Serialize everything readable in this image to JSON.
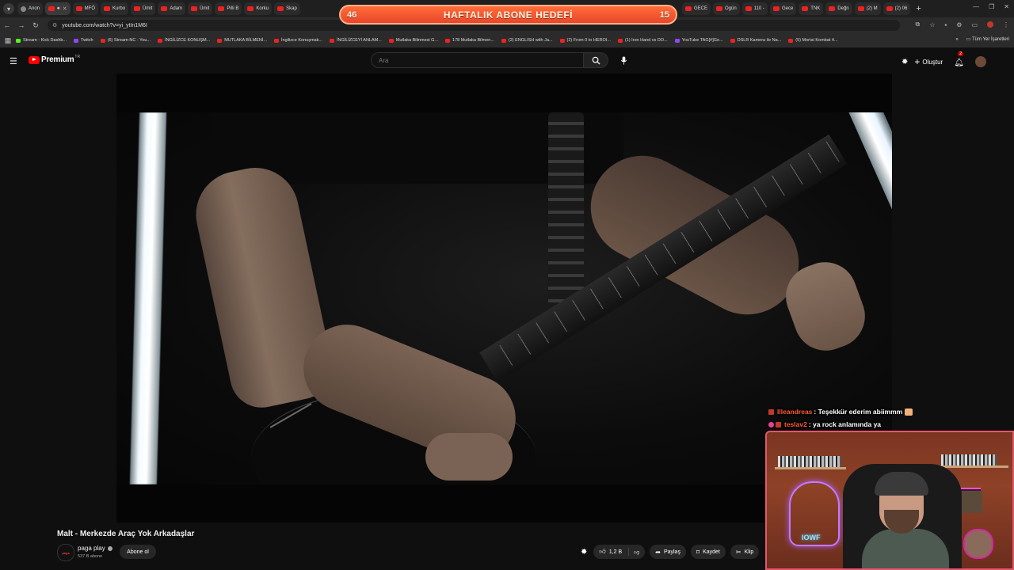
{
  "browser": {
    "tabs": [
      {
        "label": "Anon",
        "active": false
      },
      {
        "label": "",
        "active": true
      },
      {
        "label": "MFÖ",
        "active": false
      },
      {
        "label": "Kurbo",
        "active": false
      },
      {
        "label": "Ümit",
        "active": false
      },
      {
        "label": "Adam",
        "active": false
      },
      {
        "label": "Ümit",
        "active": false
      },
      {
        "label": "Pilli B",
        "active": false
      },
      {
        "label": "Korku",
        "active": false
      },
      {
        "label": "Skap",
        "active": false
      },
      {
        "label": "GECE",
        "active": false
      },
      {
        "label": "Ogün",
        "active": false
      },
      {
        "label": "110 -",
        "active": false
      },
      {
        "label": "Gece",
        "active": false
      },
      {
        "label": "TNK",
        "active": false
      },
      {
        "label": "Değn",
        "active": false
      },
      {
        "label": "(2) M",
        "active": false
      },
      {
        "label": "(2) 06",
        "active": false
      }
    ],
    "url": "youtube.com/watch?v=yi_ytIn1M6I",
    "bookmarks": [
      {
        "label": "Stream - Kick Dashb...",
        "type": "k"
      },
      {
        "label": "Twitch",
        "type": "t"
      },
      {
        "label": "(6) Stream-NC - You...",
        "type": "y"
      },
      {
        "label": "İNGİLİZCE KONUŞM...",
        "type": "y"
      },
      {
        "label": "MUTLAKA BİLMENİ...",
        "type": "y"
      },
      {
        "label": "İngilizce Konuşmak...",
        "type": "y"
      },
      {
        "label": "İNGİLİZCEYİ ANLAM...",
        "type": "y"
      },
      {
        "label": "Mutlaka Bilinmesi G...",
        "type": "y"
      },
      {
        "label": "178 Mutlaka Bilmen...",
        "type": "y"
      },
      {
        "label": "(2) ENGLISH with Ja...",
        "type": "y"
      },
      {
        "label": "(2) From 0 to HEROI...",
        "type": "y"
      },
      {
        "label": "(1) Iron Hand vs DO...",
        "type": "y"
      },
      {
        "label": "YouTube TAG[#]Ge...",
        "type": "t"
      },
      {
        "label": "DSLR Kamera ile Na...",
        "type": "y"
      },
      {
        "label": "(5) Mortal Kombat 4...",
        "type": "y"
      }
    ],
    "bookmarks_all": "Tüm Yer İşaretleri"
  },
  "goal_banner": {
    "left_value": "46",
    "title": "HAFTALIK ABONE HEDEFİ",
    "right_value": "15"
  },
  "youtube": {
    "logo_text": "Premium",
    "logo_country": "TR",
    "search_placeholder": "Ara",
    "create_label": "Oluştur",
    "notification_count": "2"
  },
  "video": {
    "title": "Malt - Merkezde Araç Yok Arkadaşlar",
    "channel_name": "paga play",
    "channel_avatar_text": "paga",
    "subscribers": "537 B abone",
    "subscribe_label": "Abone ol",
    "like_count": "1,2 B",
    "share_label": "Paylaş",
    "save_label": "Kaydet",
    "clip_label": "Klip"
  },
  "chat": [
    {
      "user": "llleandreas",
      "message": ": Teşekkür ederim abiimmm"
    },
    {
      "user": "teslav2",
      "message": ": ya rock anlamında ya"
    }
  ],
  "webcam": {
    "neon_sign": "IOWF"
  }
}
